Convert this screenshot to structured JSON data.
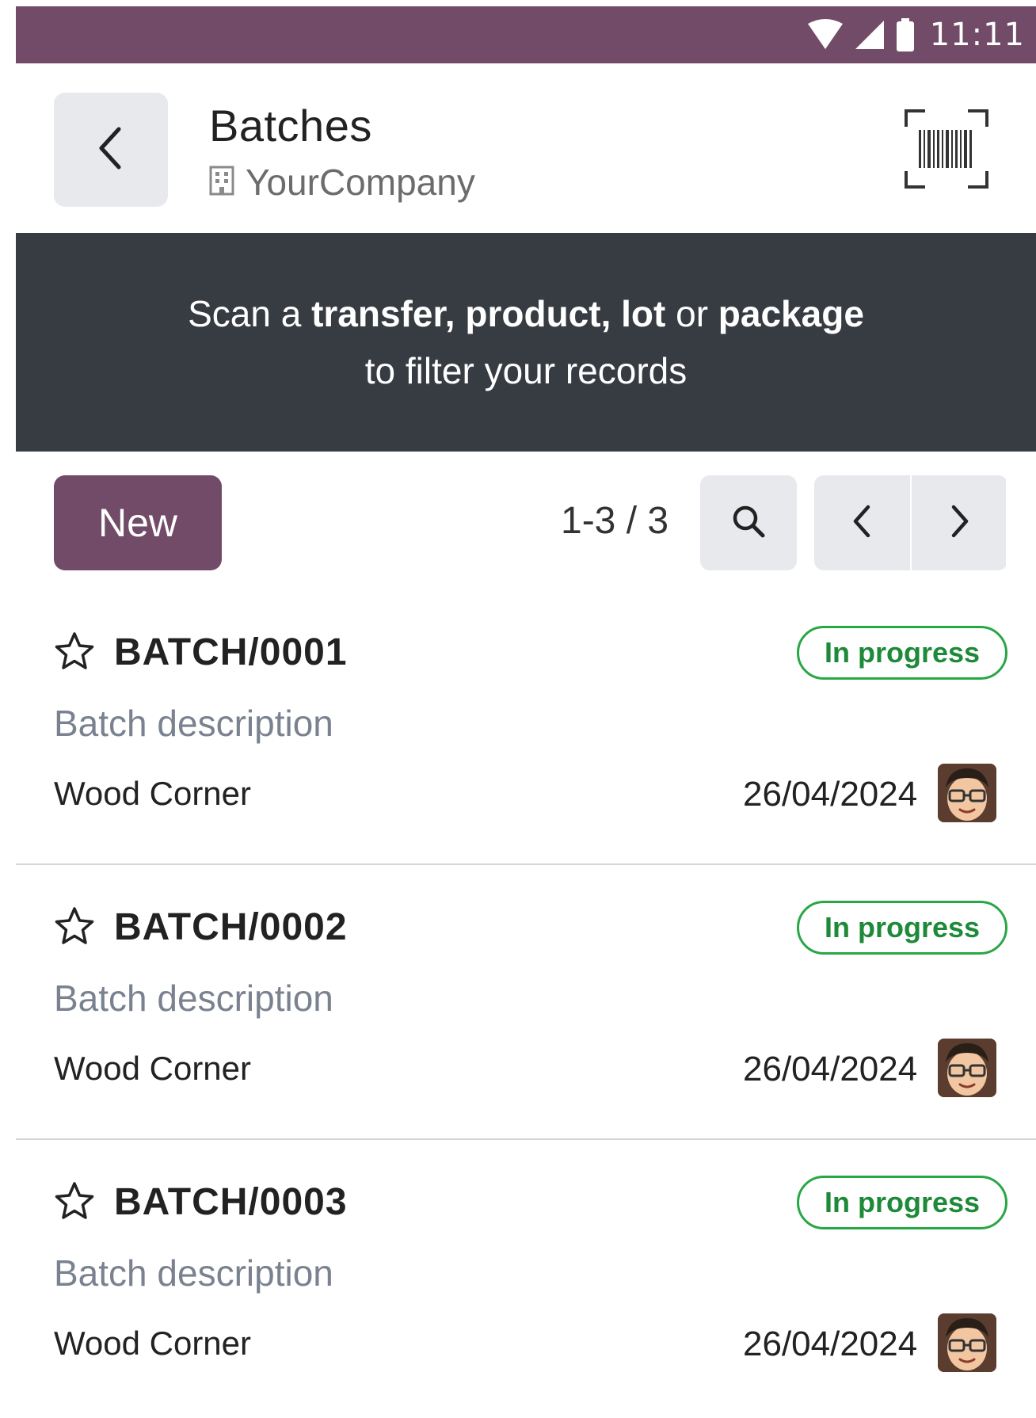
{
  "status_bar": {
    "time": "11:11",
    "bar_color": "#714b67",
    "icons": [
      "wifi-icon",
      "signal-icon",
      "battery-icon"
    ]
  },
  "header": {
    "title": "Batches",
    "company": "YourCompany",
    "back_icon": "chevron-left-icon",
    "company_icon": "building-icon",
    "barcode_icon": "barcode-scan-icon"
  },
  "banner": {
    "parts": [
      {
        "text": "Scan a ",
        "bold": false
      },
      {
        "text": "transfer, product, lot",
        "bold": true
      },
      {
        "text": " or ",
        "bold": false
      },
      {
        "text": "package",
        "bold": true
      }
    ],
    "line2": "to filter your records",
    "background": "#373c43"
  },
  "control_panel": {
    "new_label": "New",
    "pager_value": "1-3 / 3",
    "search_icon": "search-icon",
    "prev_icon": "chevron-left-icon",
    "next_icon": "chevron-right-icon",
    "brand_color": "#714b67"
  },
  "records": [
    {
      "name": "BATCH/0001",
      "status": "In progress",
      "description": "Batch description",
      "partner": "Wood Corner",
      "date": "26/04/2024"
    },
    {
      "name": "BATCH/0002",
      "status": "In progress",
      "description": "Batch description",
      "partner": "Wood Corner",
      "date": "26/04/2024"
    },
    {
      "name": "BATCH/0003",
      "status": "In progress",
      "description": "Batch description",
      "partner": "Wood Corner",
      "date": "26/04/2024"
    }
  ],
  "status_color": "#28a745"
}
